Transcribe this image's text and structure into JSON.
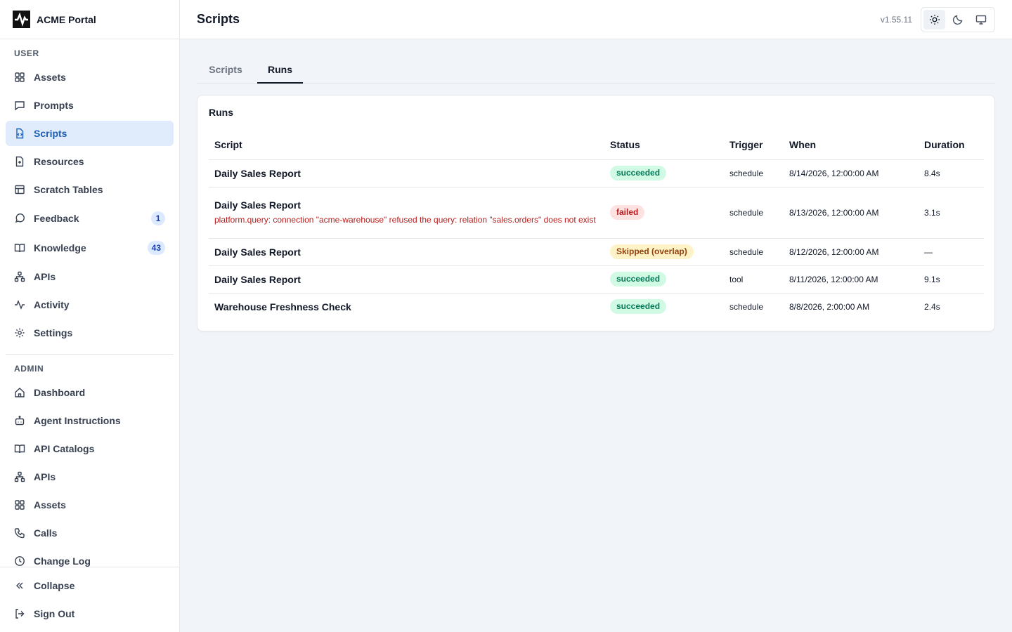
{
  "app": {
    "name": "ACME Portal",
    "version": "v1.55.11"
  },
  "sidebar": {
    "user_label": "USER",
    "admin_label": "ADMIN",
    "user_items": [
      {
        "label": "Assets",
        "icon": "grid-icon"
      },
      {
        "label": "Prompts",
        "icon": "message-square-icon"
      },
      {
        "label": "Scripts",
        "icon": "file-code-icon",
        "active": true
      },
      {
        "label": "Resources",
        "icon": "file-plus-icon"
      },
      {
        "label": "Scratch Tables",
        "icon": "table-icon"
      },
      {
        "label": "Feedback",
        "icon": "message-circle-icon",
        "badge": "1"
      },
      {
        "label": "Knowledge",
        "icon": "book-open-icon",
        "badge": "43"
      },
      {
        "label": "APIs",
        "icon": "network-icon"
      },
      {
        "label": "Activity",
        "icon": "activity-icon"
      },
      {
        "label": "Settings",
        "icon": "gear-icon"
      }
    ],
    "admin_items": [
      {
        "label": "Dashboard",
        "icon": "home-icon"
      },
      {
        "label": "Agent Instructions",
        "icon": "bot-icon"
      },
      {
        "label": "API Catalogs",
        "icon": "book-open-icon"
      },
      {
        "label": "APIs",
        "icon": "network-icon"
      },
      {
        "label": "Assets",
        "icon": "grid-icon"
      },
      {
        "label": "Calls",
        "icon": "phone-icon"
      },
      {
        "label": "Change Log",
        "icon": "clock-icon"
      }
    ],
    "footer": {
      "collapse": "Collapse",
      "sign_out": "Sign Out"
    }
  },
  "header": {
    "title": "Scripts"
  },
  "tabs": [
    {
      "label": "Scripts"
    },
    {
      "label": "Runs",
      "active": true
    }
  ],
  "runs": {
    "title": "Runs",
    "columns": [
      "Script",
      "Status",
      "Trigger",
      "When",
      "Duration"
    ],
    "rows": [
      {
        "script": "Daily Sales Report",
        "status": "succeeded",
        "status_kind": "success",
        "trigger": "schedule",
        "when": "8/14/2026, 12:00:00 AM",
        "duration": "8.4s",
        "error": ""
      },
      {
        "script": "Daily Sales Report",
        "status": "failed",
        "status_kind": "failed",
        "trigger": "schedule",
        "when": "8/13/2026, 12:00:00 AM",
        "duration": "3.1s",
        "error": "platform.query: connection \"acme-warehouse\" refused the query: relation \"sales.orders\" does not exist"
      },
      {
        "script": "Daily Sales Report",
        "status": "Skipped (overlap)",
        "status_kind": "skipped",
        "trigger": "schedule",
        "when": "8/12/2026, 12:00:00 AM",
        "duration": "—",
        "error": ""
      },
      {
        "script": "Daily Sales Report",
        "status": "succeeded",
        "status_kind": "success",
        "trigger": "tool",
        "when": "8/11/2026, 12:00:00 AM",
        "duration": "9.1s",
        "error": ""
      },
      {
        "script": "Warehouse Freshness Check",
        "status": "succeeded",
        "status_kind": "success",
        "trigger": "schedule",
        "when": "8/8/2026, 2:00:00 AM",
        "duration": "2.4s",
        "error": ""
      }
    ]
  },
  "colors": {
    "accent": "#1e5fb3",
    "active_bg": "#e0ecfb",
    "error": "#b91c1c"
  }
}
